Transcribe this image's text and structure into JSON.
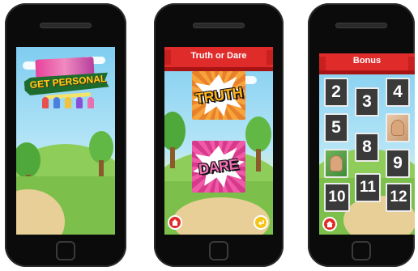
{
  "phone1": {
    "logo_title": "GET PERSONAL",
    "logo_subtitle": ""
  },
  "phone2": {
    "header_title": "Truth or Dare",
    "truth_label": "TRUTH",
    "dare_label": "DARE"
  },
  "phone3": {
    "header_title": "Bonus",
    "tiles": [
      "2",
      "3",
      "4",
      "5",
      "",
      "8",
      "",
      "9",
      "10",
      "11",
      "12"
    ]
  },
  "colors": {
    "banner_red": "#e02b2b",
    "truth_bg": "#f2932a",
    "dare_bg": "#e8489a",
    "truth_text": "#ffb21a",
    "dare_text": "#f06fb6",
    "tile_bg": "#3a3a3a"
  },
  "icons": {
    "home": "house-icon",
    "back": "return-arrow-icon"
  }
}
